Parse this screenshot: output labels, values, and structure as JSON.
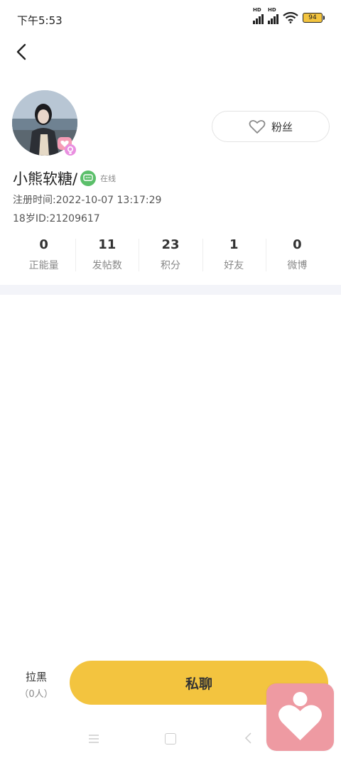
{
  "status_bar": {
    "time": "下午5:53",
    "battery": "94",
    "hd1": "HD",
    "hd2": "HD"
  },
  "profile": {
    "username": "小熊软糖/",
    "online_status": "在线",
    "register_time": "注册时间:2022-10-07 13:17:29",
    "user_id": "18岁ID:21209617",
    "fans_label": "粉丝"
  },
  "stats": [
    {
      "value": "0",
      "label": "正能量"
    },
    {
      "value": "11",
      "label": "发帖数"
    },
    {
      "value": "23",
      "label": "积分"
    },
    {
      "value": "1",
      "label": "好友"
    },
    {
      "value": "0",
      "label": "微博"
    }
  ],
  "footer": {
    "block_label": "拉黑",
    "block_count": "（0人）",
    "chat_label": "私聊"
  },
  "colors": {
    "accent": "#f3c43f",
    "divider": "#f3f4f9",
    "online": "#5bbf6a",
    "floating_app": "#ee9aa2"
  },
  "icons": [
    "back-arrow-icon",
    "heart-outline-icon",
    "chat-bubble-icon",
    "menu-icon",
    "home-icon",
    "nav-back-icon",
    "heart-app-icon",
    "wifi-icon",
    "signal-icon",
    "battery-icon"
  ]
}
